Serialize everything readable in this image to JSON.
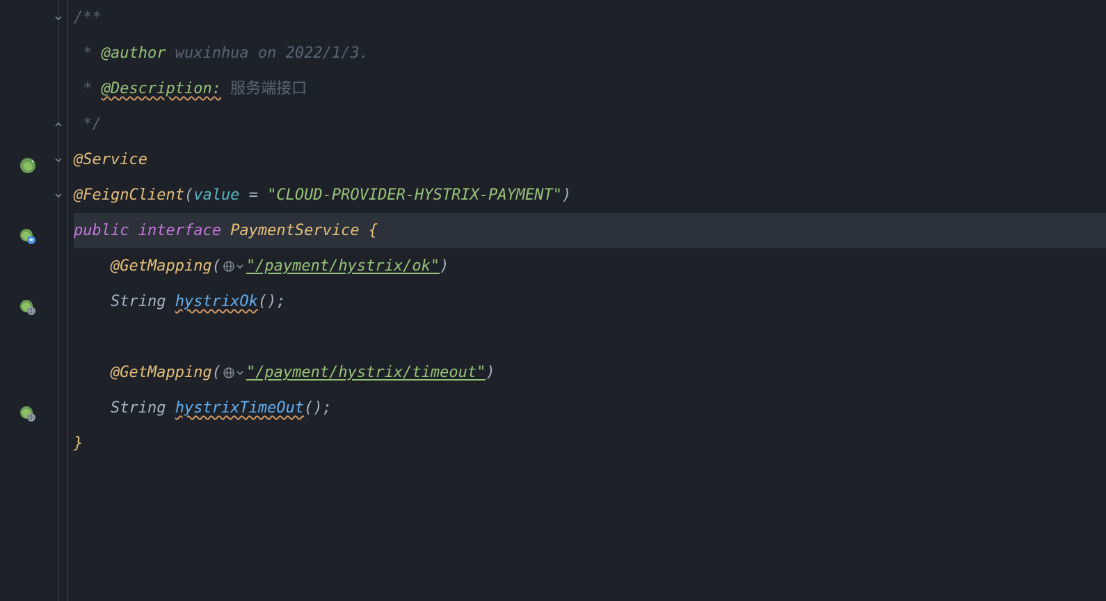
{
  "code": {
    "comment_open": "/**",
    "comment_star": " * ",
    "author_tag": "@author",
    "author_text": " wuxinhua on 2022/1/3.",
    "desc_tag": "@Description:",
    "desc_text": " 服务端接口",
    "comment_close": " */",
    "service_annotation": "@Service",
    "feign_annotation": "@FeignClient",
    "feign_open": "(",
    "feign_attr": "value",
    "feign_eq": " = ",
    "feign_value": "\"CLOUD-PROVIDER-HYSTRIX-PAYMENT\"",
    "feign_close": ")",
    "public_kw": "public",
    "interface_kw": " interface ",
    "interface_name": "PaymentService",
    "brace_open": " {",
    "indent": "    ",
    "get_mapping": "@GetMapping",
    "gm_open": "(",
    "path_ok": "\"/payment/hystrix/ok\"",
    "gm_close": ")",
    "string_type": "String ",
    "method_ok": "hystrixOk",
    "method_parens": "();",
    "path_timeout": "\"/payment/hystrix/timeout\"",
    "method_timeout": "hystrixTimeOut",
    "brace_close": "}"
  }
}
